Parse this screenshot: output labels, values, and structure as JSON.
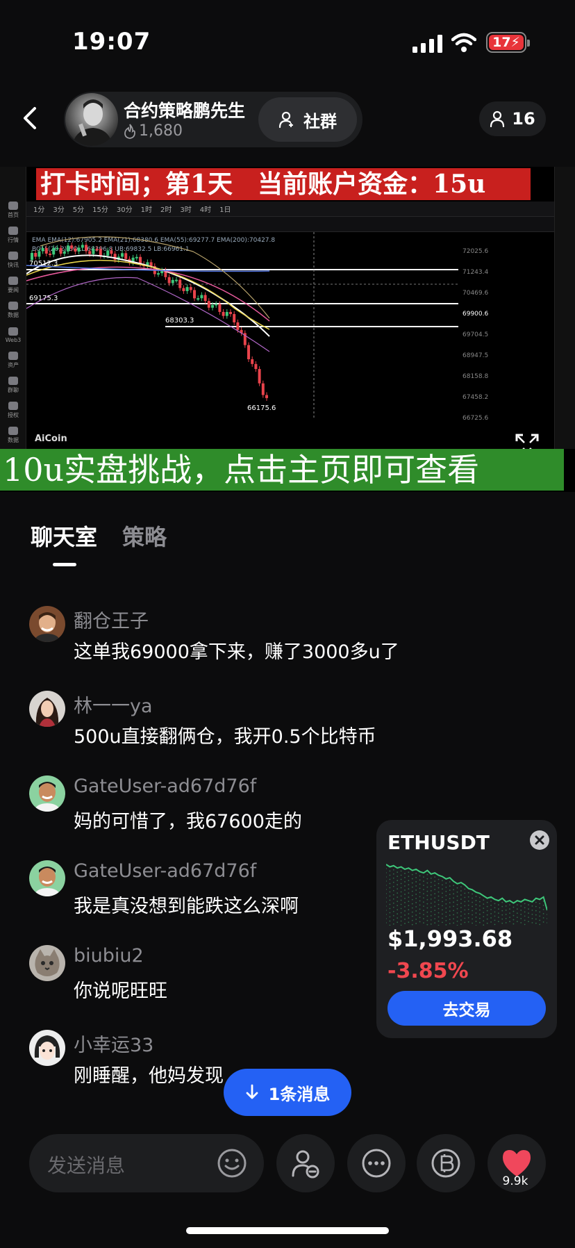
{
  "status_bar": {
    "time": "19:07",
    "battery": "17"
  },
  "header": {
    "host_name": "合约策略鹏先生",
    "host_heat": "1,680",
    "community_label": "社群",
    "member_count": "16"
  },
  "video": {
    "banner_top": "打卡时间；第1天　当前账户资金：15u",
    "banner_bottom": "10u实盘挑战，点击主页即可查看",
    "brand": "AiCoin",
    "price_labels": [
      "72025.6",
      "71243.4",
      "70469.6",
      "69900.6",
      "69704.5",
      "68947.5",
      "68158.8",
      "67458.2",
      "66725.6"
    ],
    "level_labels": [
      "70512.3",
      "69175.3",
      "68303.3",
      "66175.6"
    ],
    "toolbar_items": [
      "1分",
      "3分",
      "5分",
      "15分",
      "30分",
      "1时",
      "2时",
      "3时",
      "4时",
      "1日"
    ],
    "indicator_line": "EMA  EMA(12):67905.2  EMA(21):68380.6  EMA(55):69277.7  EMA(200):70427.8",
    "boll_line": "BOLL(20,2)  BOLL:68396.8  UB:69832.5  LB:66961.1",
    "rail_labels": [
      "首页",
      "行情",
      "快讯",
      "要闻",
      "数据",
      "Web3",
      "资产",
      "群聊",
      "授权",
      "数据"
    ],
    "colors": {
      "banner_top": "#c8201e",
      "banner_bottom": "#2f8c2a"
    }
  },
  "tabs": [
    {
      "label": "聊天室",
      "active": true
    },
    {
      "label": "策略",
      "active": false
    }
  ],
  "messages": [
    {
      "user": "翻仓王子",
      "text": "这单我69000拿下来，赚了3000多u了",
      "avatar": "man-smiling"
    },
    {
      "user": "林一一ya",
      "text": "500u直接翻俩仓，我开0.5个比特币",
      "avatar": "woman"
    },
    {
      "user": "GateUser-ad67d76f",
      "text": "妈的可惜了，我67600走的",
      "avatar": "man-green"
    },
    {
      "user": "GateUser-ad67d76f",
      "text": "我是真没想到能跌这么深啊",
      "avatar": "man-green"
    },
    {
      "user": "biubiu2",
      "text": "你说呢旺旺",
      "avatar": "cat"
    },
    {
      "user": "小幸运33",
      "text": "刚睡醒，他妈发现",
      "avatar": "anime-girl"
    }
  ],
  "eth_card": {
    "symbol": "ETHUSDT",
    "price": "$1,993.68",
    "change": "-3.85%",
    "button_label": "去交易",
    "spark_values": [
      1.0,
      0.98,
      0.99,
      0.97,
      0.98,
      0.96,
      0.97,
      0.95,
      0.96,
      0.94,
      0.93,
      0.95,
      0.92,
      0.93,
      0.91,
      0.9,
      0.88,
      0.89,
      0.86,
      0.84,
      0.85,
      0.83,
      0.8,
      0.79,
      0.77,
      0.76,
      0.74,
      0.72,
      0.73,
      0.71,
      0.7,
      0.72,
      0.69,
      0.7,
      0.68,
      0.7,
      0.69,
      0.71,
      0.7,
      0.69,
      0.72,
      0.71,
      0.73,
      0.62
    ],
    "colors": {
      "change": "#f0474f",
      "button": "#2461f4",
      "spark": "#3ec77a"
    }
  },
  "new_message_label": "1条消息",
  "input": {
    "placeholder": "发送消息"
  },
  "like_count": "9.9k"
}
